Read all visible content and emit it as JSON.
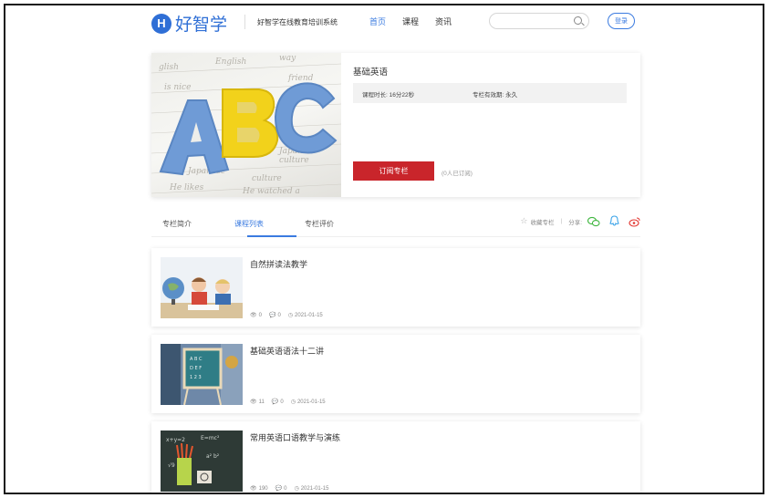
{
  "header": {
    "logo_mark": "H",
    "logo_text": "好智学",
    "logo_subtitle": "好智学在线教育培训系统",
    "nav": [
      "首页",
      "课程",
      "资讯"
    ],
    "search_placeholder": "",
    "login_label": "登录"
  },
  "course": {
    "title": "基础英语",
    "duration": "课程时长: 16分22秒",
    "validity": "专栏有效期: 永久",
    "subscribe_label": "订阅专栏",
    "subscribers": "(0人已订阅)",
    "cover_text": "ABC"
  },
  "tabs": [
    "专栏简介",
    "课程列表",
    "专栏评价"
  ],
  "tools": {
    "favorite": "收藏专栏",
    "separator": "|",
    "share": "分享:"
  },
  "lessons": [
    {
      "title": "自然拼读法教学",
      "views": "0",
      "comments": "0",
      "date": "2021-01-15"
    },
    {
      "title": "基础英语语法十二讲",
      "views": "11",
      "comments": "0",
      "date": "2021-01-15"
    },
    {
      "title": "常用英语口语教学与演练",
      "views": "190",
      "comments": "0",
      "date": "2021-01-15"
    }
  ],
  "colors": {
    "brand": "#2f6fd6",
    "accent": "#3b7be0",
    "subscribe": "#c9252b"
  },
  "icons": [
    "search-icon",
    "star-icon",
    "wechat-icon",
    "qq-icon",
    "weibo-icon",
    "eye-icon",
    "comment-icon",
    "clock-icon"
  ]
}
